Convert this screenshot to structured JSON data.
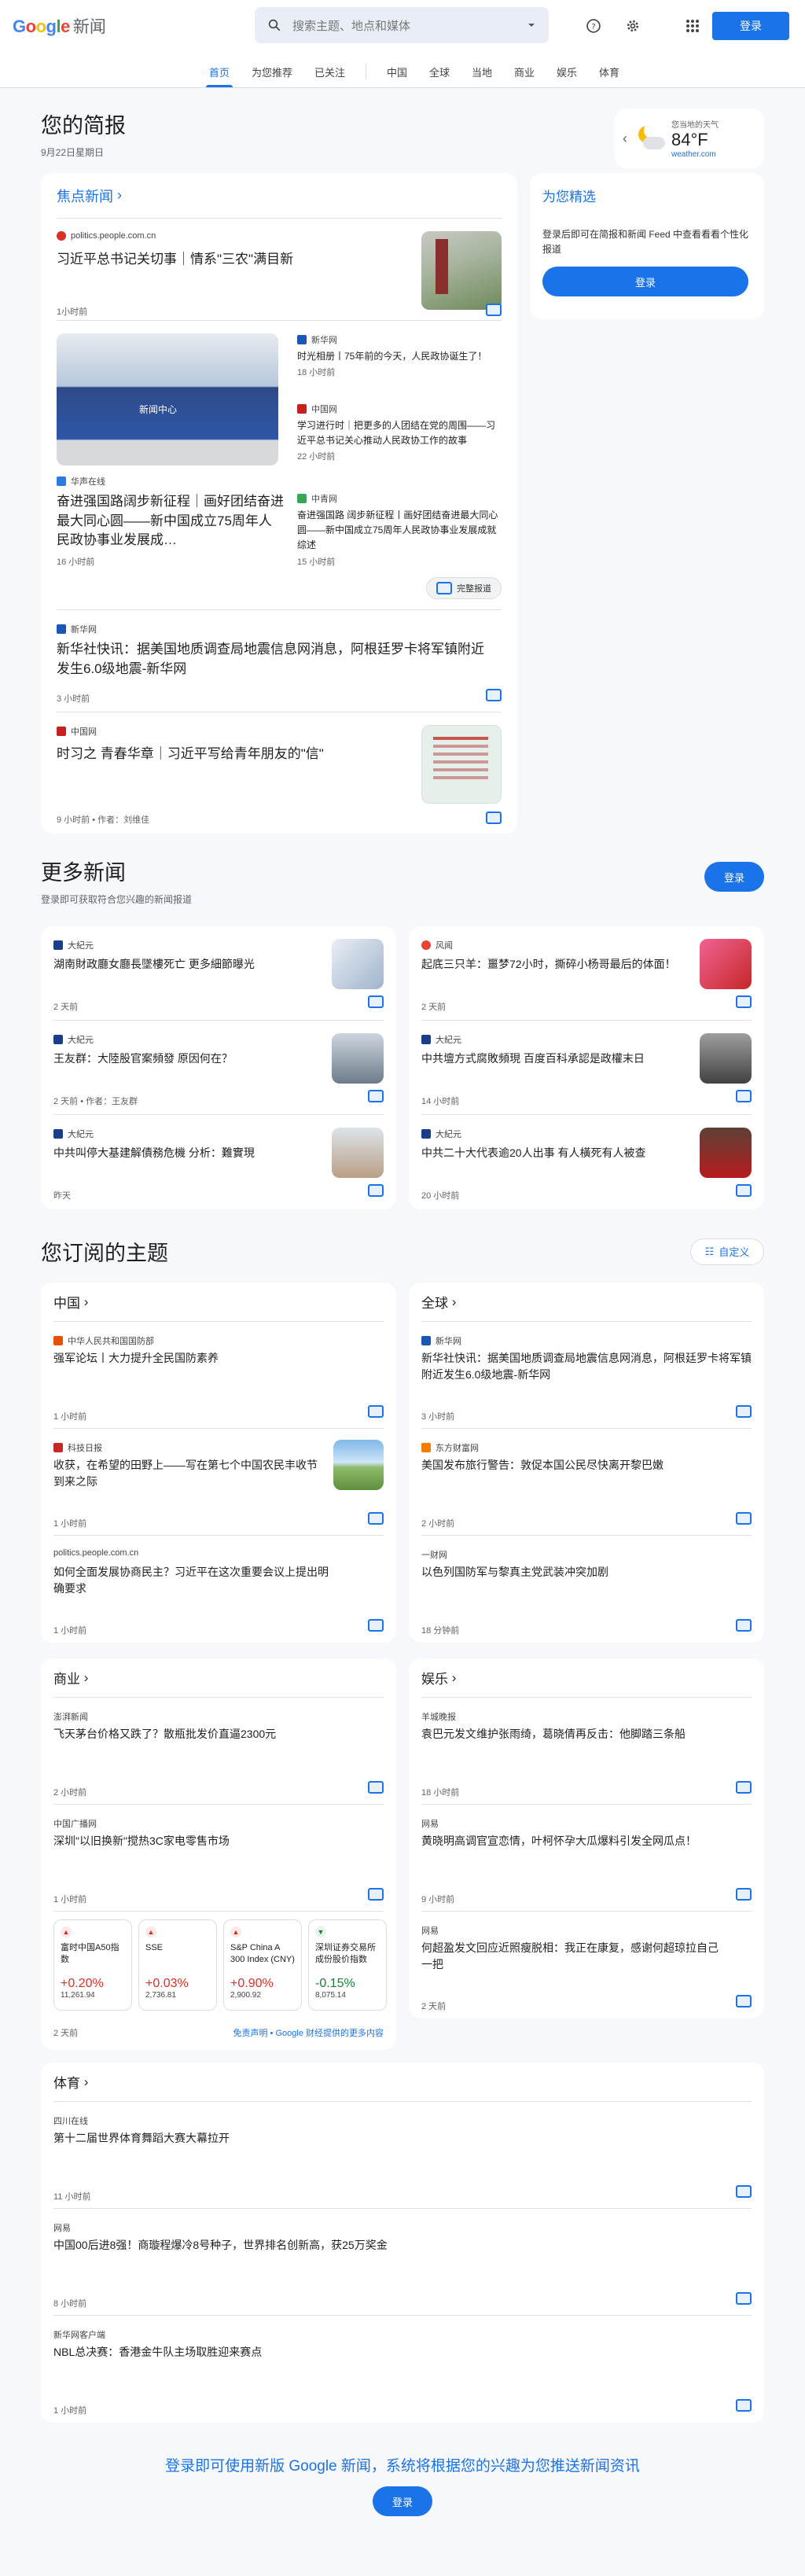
{
  "header": {
    "logo_brand": "Google",
    "logo_product": "新闻",
    "search_placeholder": "搜索主题、地点和媒体",
    "signin_label": "登录"
  },
  "nav": {
    "tabs": [
      "首页",
      "为您推荐",
      "已关注"
    ],
    "sections": [
      "中国",
      "全球",
      "当地",
      "商业",
      "娱乐",
      "体育"
    ]
  },
  "briefing": {
    "title": "您的简报",
    "date": "9月22日星期日",
    "weather": {
      "location": "您当地的天气",
      "temp": "84°F",
      "source": "weather.com"
    }
  },
  "focus": {
    "heading": "焦点新闻",
    "article1": {
      "source": "politics.people.com.cn",
      "title": "习近平总书记关切事｜情系\"三农\"满目新",
      "time": "1小时前"
    },
    "cluster": {
      "main": {
        "source": "华声在线",
        "title": "奋进强国路阔步新征程｜画好团结奋进最大同心圆——新中国成立75周年人民政协事业发展成…",
        "time": "16 小时前"
      },
      "side": [
        {
          "source": "新华网",
          "title": "时光相册丨75年前的今天，人民政协诞生了！",
          "time": "18 小时前"
        },
        {
          "source": "中国网",
          "title": "学习进行时｜把更多的人团结在党的周围——习近平总书记关心推动人民政协工作的故事",
          "time": "22 小时前"
        },
        {
          "source": "中青网",
          "title": "奋进强国路 阔步新征程丨画好团结奋进最大同心圆——新中国成立75周年人民政协事业发展成就综述",
          "time": "15 小时前"
        }
      ],
      "full_coverage_label": "完整报道"
    },
    "article2": {
      "source": "新华网",
      "title": "新华社快讯：据美国地质调查局地震信息网消息，阿根廷罗卡将军镇附近发生6.0级地震-新华网",
      "time": "3 小时前"
    },
    "article3": {
      "source": "中国网",
      "title": "时习之 青春华章｜习近平写给青年朋友的\"信\"",
      "time": "9 小时前",
      "author": "作者：刘维佳"
    }
  },
  "picks": {
    "heading": "为您精选",
    "text": "登录后即可在简报和新闻 Feed 中查看看看个性化报道",
    "button": "登录"
  },
  "more_news": {
    "title": "更多新闻",
    "subtitle": "登录即可获取符合您兴趣的新闻报道",
    "button": "登录",
    "left": [
      {
        "source": "大紀元",
        "title": "湖南財政廳女廳長墜樓死亡 更多細節曝光",
        "time": "2 天前"
      },
      {
        "source": "大紀元",
        "title": "王友群：大陸股官案頻發 原因何在？",
        "time": "2 天前 • 作者：王友群"
      },
      {
        "source": "大紀元",
        "title": "中共叫停大基建解債務危機 分析：難實現",
        "time": "昨天"
      }
    ],
    "right": [
      {
        "source": "风闻",
        "title": "起底三只羊：噩梦72小时，撕碎小杨哥最后的体面！",
        "time": "2 天前"
      },
      {
        "source": "大紀元",
        "title": "中共壇方式腐敗頻現 百度百科承認是政權末日",
        "time": "14 小时前"
      },
      {
        "source": "大紀元",
        "title": "中共二十大代表逾20人出事 有人橫死有人被查",
        "time": "20 小时前"
      }
    ]
  },
  "topics": {
    "title": "您订阅的主题",
    "customize": "自定义",
    "china": {
      "heading": "中国",
      "items": [
        {
          "source": "中华人民共和国国防部",
          "title": "强军论坛丨大力提升全民国防素养",
          "time": "1 小时前"
        },
        {
          "source": "科技日报",
          "title": "收获，在希望的田野上——写在第七个中国农民丰收节到来之际",
          "time": "1 小时前"
        },
        {
          "source": "politics.people.com.cn",
          "title": "如何全面发展协商民主？习近平在这次重要会议上提出明确要求",
          "time": "1 小时前"
        }
      ]
    },
    "world": {
      "heading": "全球",
      "items": [
        {
          "source": "新华网",
          "title": "新华社快讯：据美国地质调查局地震信息网消息，阿根廷罗卡将军镇附近发生6.0级地震-新华网",
          "time": "3 小时前"
        },
        {
          "source": "东方财富网",
          "title": "美国发布旅行警告：敦促本国公民尽快离开黎巴嫩",
          "time": "2 小时前"
        },
        {
          "source": "一财网",
          "title": "以色列国防军与黎真主党武装冲突加剧",
          "time": "18 分钟前"
        }
      ]
    },
    "business": {
      "heading": "商业",
      "items": [
        {
          "source": "澎湃新闻",
          "title": "飞天茅台价格又跌了？散瓶批发价直逼2300元",
          "time": "2 小时前"
        },
        {
          "source": "中国广播网",
          "title": "深圳\"以旧换新\"搅热3C家电零售市场",
          "time": "1 小时前"
        }
      ],
      "stocks": [
        {
          "name": "富时中国A50指数",
          "pct": "+0.20%",
          "value": "11,261.94",
          "dir": "up"
        },
        {
          "name": "SSE",
          "pct": "+0.03%",
          "value": "2,736.81",
          "dir": "up"
        },
        {
          "name": "S&P China A 300 Index (CNY)",
          "pct": "+0.90%",
          "value": "2,900.92",
          "dir": "up"
        },
        {
          "name": "深圳证券交易所成份股价指数",
          "pct": "-0.15%",
          "value": "8,075.14",
          "dir": "down"
        }
      ],
      "stocks_time": "2 天前",
      "stocks_note": "免责声明 • Google 财经提供的更多内容"
    },
    "entertainment": {
      "heading": "娱乐",
      "items": [
        {
          "source": "羊城晚报",
          "title": "袁巴元发文维护张雨绮，葛晓倩再反击：他脚踏三条船",
          "time": "18 小时前"
        },
        {
          "source": "网易",
          "title": "黄晓明高调官宣恋情，叶柯怀孕大瓜爆料引发全网瓜点！",
          "time": "9 小时前"
        },
        {
          "source": "网易",
          "title": "何超盈发文回应近照瘦脱相：我正在康复，感谢何超琼拉自己一把",
          "time": "2 天前"
        }
      ]
    },
    "sports": {
      "heading": "体育",
      "items": [
        {
          "source": "四川在线",
          "title": "第十二届世界体育舞蹈大赛大幕拉开",
          "time": "11 小时前"
        },
        {
          "source": "网易",
          "title": "中国00后进8强！商璇程爆冷8号种子，世界排名创新高，获25万奖金",
          "time": "8 小时前"
        },
        {
          "source": "新华网客户端",
          "title": "NBL总决赛：香港金牛队主场取胜迎来赛点",
          "time": "1 小时前"
        }
      ]
    }
  },
  "footer": {
    "cta": "登录即可使用新版 Google 新闻，系统将根据您的兴趣为您推送新闻资讯",
    "button": "登录"
  }
}
